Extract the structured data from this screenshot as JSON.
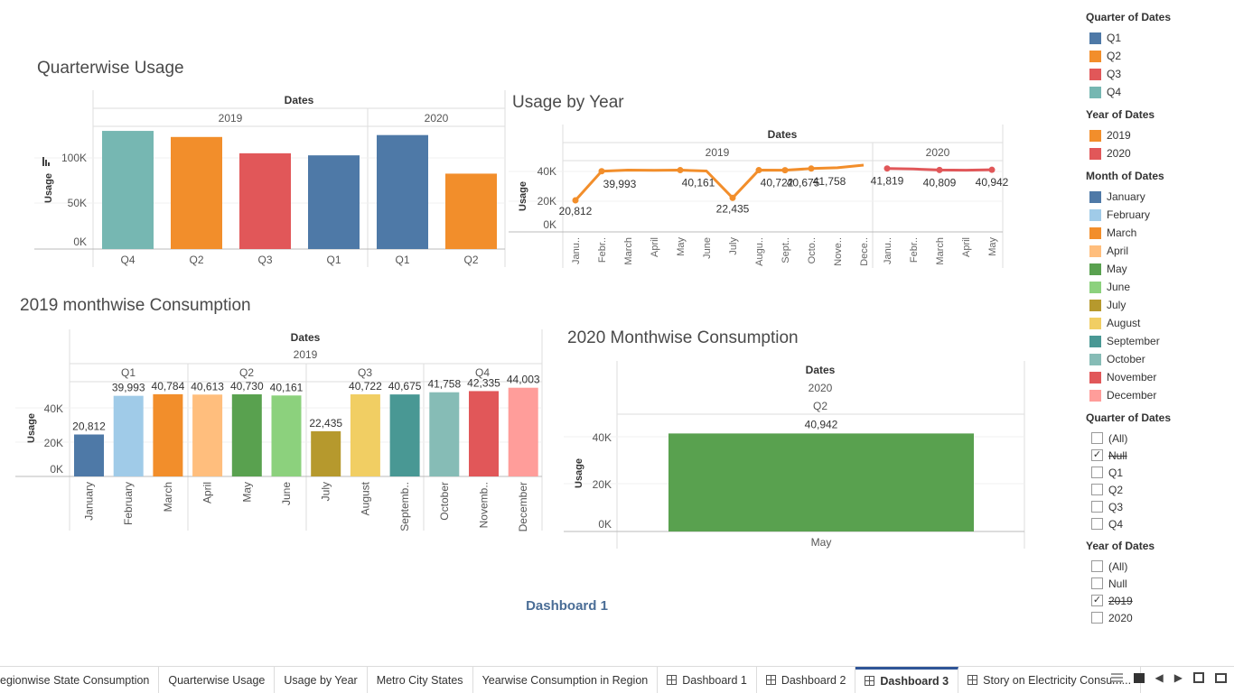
{
  "colors": {
    "Q1": "#4e79a7",
    "Q2": "#f28e2b",
    "Q3": "#e15759",
    "Q4": "#76b7b2",
    "y2019": "#f28e2b",
    "y2020": "#e15759",
    "January": "#4e79a7",
    "February": "#a0cbe8",
    "March": "#f28e2b",
    "April": "#ffbe7d",
    "May": "#59a14f",
    "June": "#8cd17d",
    "July": "#b6992d",
    "August": "#f1ce63",
    "September": "#499894",
    "October": "#86bcb6",
    "November": "#e15759",
    "December": "#ff9d9a"
  },
  "charts": {
    "quarterwise": {
      "title": "Quarterwise Usage",
      "header": "Dates",
      "years": [
        "2019",
        "2020"
      ],
      "ylabel": "Usage",
      "ticks": [
        "100K",
        "50K",
        "0K"
      ]
    },
    "usage_by_year": {
      "title": "Usage by Year",
      "header": "Dates",
      "years": [
        "2019",
        "2020"
      ],
      "ylabel": "Usage",
      "ticks": [
        "40K",
        "20K",
        "0K"
      ]
    },
    "monthwise_2019": {
      "title": "2019 monthwise Consumption",
      "header": "Dates",
      "year": "2019",
      "quarters": [
        "Q1",
        "Q2",
        "Q3",
        "Q4"
      ],
      "ylabel": "Usage",
      "ticks": [
        "40K",
        "20K",
        "0K"
      ]
    },
    "monthwise_2020": {
      "title": "2020 Monthwise Consumption",
      "header": "Dates",
      "year": "2020",
      "quarter": "Q2",
      "ylabel": "Usage",
      "ticks": [
        "40K",
        "20K",
        "0K"
      ]
    }
  },
  "chart_data": [
    {
      "type": "bar",
      "title": "Quarterwise Usage",
      "ylabel": "Usage",
      "ylim": [
        0,
        135000
      ],
      "categories": [
        "Q4",
        "Q2",
        "Q3",
        "Q1",
        "Q1",
        "Q2"
      ],
      "groups": [
        "2019",
        "2019",
        "2019",
        "2019",
        "2020",
        "2020"
      ],
      "values": [
        128096,
        121503,
        103832,
        101589,
        123571,
        81751
      ],
      "colors": [
        "#76b7b2",
        "#f28e2b",
        "#e15759",
        "#4e79a7",
        "#4e79a7",
        "#f28e2b"
      ]
    },
    {
      "type": "line",
      "title": "Usage by Year",
      "ylabel": "Usage",
      "ylim": [
        0,
        47000
      ],
      "series": [
        {
          "name": "2019",
          "x": [
            "Janu..",
            "Febr..",
            "March",
            "April",
            "May",
            "June",
            "July",
            "Augu..",
            "Sept..",
            "Octo..",
            "Nove..",
            "Dece.."
          ],
          "values": [
            20812,
            39993,
            40784,
            40613,
            40730,
            40161,
            22435,
            40722,
            40675,
            41758,
            42335,
            44003
          ],
          "labels": [
            "20,812",
            "39,993",
            "",
            "",
            "40,161",
            "",
            "22,435",
            "40,722",
            "40,675",
            "41,758",
            "",
            ""
          ]
        },
        {
          "name": "2020",
          "x": [
            "Janu..",
            "Febr..",
            "March",
            "April",
            "May"
          ],
          "values": [
            41819,
            41500,
            40809,
            40700,
            40942
          ],
          "labels": [
            "41,819",
            "",
            "40,809",
            "",
            "40,942"
          ]
        }
      ]
    },
    {
      "type": "bar",
      "title": "2019 monthwise Consumption",
      "ylabel": "Usage",
      "ylim": [
        0,
        47000
      ],
      "categories": [
        "January",
        "February",
        "March",
        "April",
        "May",
        "June",
        "July",
        "August",
        "Septemb..",
        "October",
        "Novemb..",
        "December"
      ],
      "values": [
        20812,
        39993,
        40784,
        40613,
        40730,
        40161,
        22435,
        40722,
        40675,
        41758,
        42335,
        44003
      ],
      "labels": [
        "20,812",
        "39,993",
        "40,784",
        "40,613",
        "40,730",
        "40,161",
        "22,435",
        "40,722",
        "40,675",
        "41,758",
        "42,335",
        "44,003"
      ],
      "colors": [
        "#4e79a7",
        "#a0cbe8",
        "#f28e2b",
        "#ffbe7d",
        "#59a14f",
        "#8cd17d",
        "#b6992d",
        "#f1ce63",
        "#499894",
        "#86bcb6",
        "#e15759",
        "#ff9d9a"
      ]
    },
    {
      "type": "bar",
      "title": "2020 Monthwise Consumption",
      "ylabel": "Usage",
      "ylim": [
        0,
        49000
      ],
      "categories": [
        "May"
      ],
      "values": [
        40942
      ],
      "labels": [
        "40,942"
      ],
      "colors": [
        "#59a14f"
      ]
    }
  ],
  "legends": {
    "quarter": {
      "title": "Quarter of Dates",
      "items": [
        {
          "label": "Q1",
          "color": "#4e79a7"
        },
        {
          "label": "Q2",
          "color": "#f28e2b"
        },
        {
          "label": "Q3",
          "color": "#e15759"
        },
        {
          "label": "Q4",
          "color": "#76b7b2"
        }
      ]
    },
    "year": {
      "title": "Year of Dates",
      "items": [
        {
          "label": "2019",
          "color": "#f28e2b"
        },
        {
          "label": "2020",
          "color": "#e15759"
        }
      ]
    },
    "month": {
      "title": "Month of Dates",
      "items": [
        {
          "label": "January",
          "color": "#4e79a7"
        },
        {
          "label": "February",
          "color": "#a0cbe8"
        },
        {
          "label": "March",
          "color": "#f28e2b"
        },
        {
          "label": "April",
          "color": "#ffbe7d"
        },
        {
          "label": "May",
          "color": "#59a14f"
        },
        {
          "label": "June",
          "color": "#8cd17d"
        },
        {
          "label": "July",
          "color": "#b6992d"
        },
        {
          "label": "August",
          "color": "#f1ce63"
        },
        {
          "label": "September",
          "color": "#499894"
        },
        {
          "label": "October",
          "color": "#86bcb6"
        },
        {
          "label": "November",
          "color": "#e15759"
        },
        {
          "label": "December",
          "color": "#ff9d9a"
        }
      ]
    }
  },
  "filters": {
    "quarter": {
      "title": "Quarter of Dates",
      "items": [
        {
          "label": "(All)",
          "checked": false,
          "strike": false
        },
        {
          "label": "Null",
          "checked": true,
          "strike": true
        },
        {
          "label": "Q1",
          "checked": false,
          "strike": false
        },
        {
          "label": "Q2",
          "checked": false,
          "strike": false
        },
        {
          "label": "Q3",
          "checked": false,
          "strike": false
        },
        {
          "label": "Q4",
          "checked": false,
          "strike": false
        }
      ]
    },
    "year": {
      "title": "Year of Dates",
      "items": [
        {
          "label": "(All)",
          "checked": false,
          "strike": false
        },
        {
          "label": "Null",
          "checked": false,
          "strike": false
        },
        {
          "label": "2019",
          "checked": true,
          "strike": true
        },
        {
          "label": "2020",
          "checked": false,
          "strike": false
        }
      ]
    }
  },
  "dashboard_caption": "Dashboard 1",
  "tabs": [
    {
      "label": "egionwise State Consumption",
      "icon": false,
      "active": false
    },
    {
      "label": "Quarterwise Usage",
      "icon": false,
      "active": false
    },
    {
      "label": "Usage by Year",
      "icon": false,
      "active": false
    },
    {
      "label": "Metro City States",
      "icon": false,
      "active": false
    },
    {
      "label": "Yearwise Consumption in Region",
      "icon": false,
      "active": false
    },
    {
      "label": "Dashboard 1",
      "icon": true,
      "active": false
    },
    {
      "label": "Dashboard 2",
      "icon": true,
      "active": false
    },
    {
      "label": "Dashboard 3",
      "icon": true,
      "active": true
    },
    {
      "label": "Story on Electricity Consum...",
      "icon": true,
      "active": false
    }
  ]
}
